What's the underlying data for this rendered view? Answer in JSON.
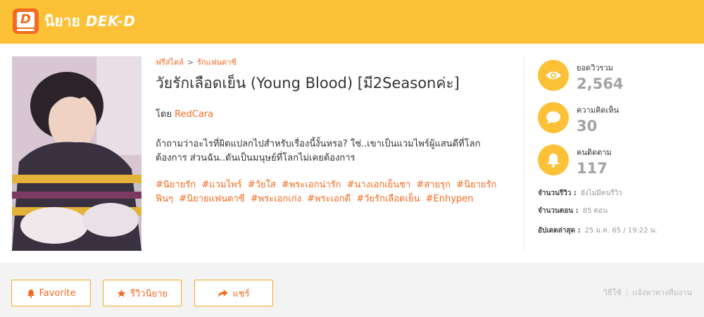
{
  "header": {
    "logo_glyph": "D",
    "logo_thai": "นิยาย",
    "logo_brand": "DEK-D",
    "bg_color": "#fcc136",
    "logo_color": "#f26b21"
  },
  "novel": {
    "breadcrumb": [
      "ฟรีสไตล์",
      "รักแฟนตาซี"
    ],
    "breadcrumb_separator": ">",
    "title": "วัยรักเลือดเย็น (Young Blood) [มี2Seasonค่ะ]",
    "author_prefix": "โดย",
    "author": "RedCara",
    "description": "ถ้าถามว่าอะไรที่ผิดแปลกไปสำหรับเรื่องนี้งั้นหรอ? ใช่..เขาเป็นแวมไพร์ผู้แสนดีที่โลกต้องการ ส่วนฉัน..ดันเป็นมนุษย์ที่โลกไม่เคยต้องการ",
    "tags": [
      "#นิยายรัก",
      "#แวมไพร์",
      "#วัยใส",
      "#พระเอกน่ารัก",
      "#นางเอกเย็นชา",
      "#สายรุก",
      "#นิยายรักฟินๆ",
      "#นิยายแฟนตาซี",
      "#พระเอกเก่ง",
      "#พระเอกดี",
      "#วัยรักเลือดเย็น",
      "#Enhypen"
    ]
  },
  "stats": {
    "views": {
      "label": "ยอดวิวรวม",
      "value": "2,564",
      "icon": "eye-icon"
    },
    "comments": {
      "label": "ความคิดเห็น",
      "value": "30",
      "icon": "speech-bubble-icon"
    },
    "followers": {
      "label": "คนติดตาม",
      "value": "117",
      "icon": "bell-icon"
    }
  },
  "meta": {
    "reviews_label": "จำนวนรีวิว :",
    "reviews_value": "ยังไม่มีคนรีวิว",
    "episodes_label": "จำนวนตอน :",
    "episodes_value": "85 ตอน",
    "updated_label": "อัปเดตล่าสุด :",
    "updated_value": "25 ม.ค. 65 / 19:22 น."
  },
  "actions": {
    "favorite_label": "Favorite",
    "review_label": "รีวิวนิยาย",
    "share_label": "แชร์"
  },
  "footer": {
    "how_to": "วิธีใช้",
    "report": "แจ้งหาทางทีมงาน"
  }
}
